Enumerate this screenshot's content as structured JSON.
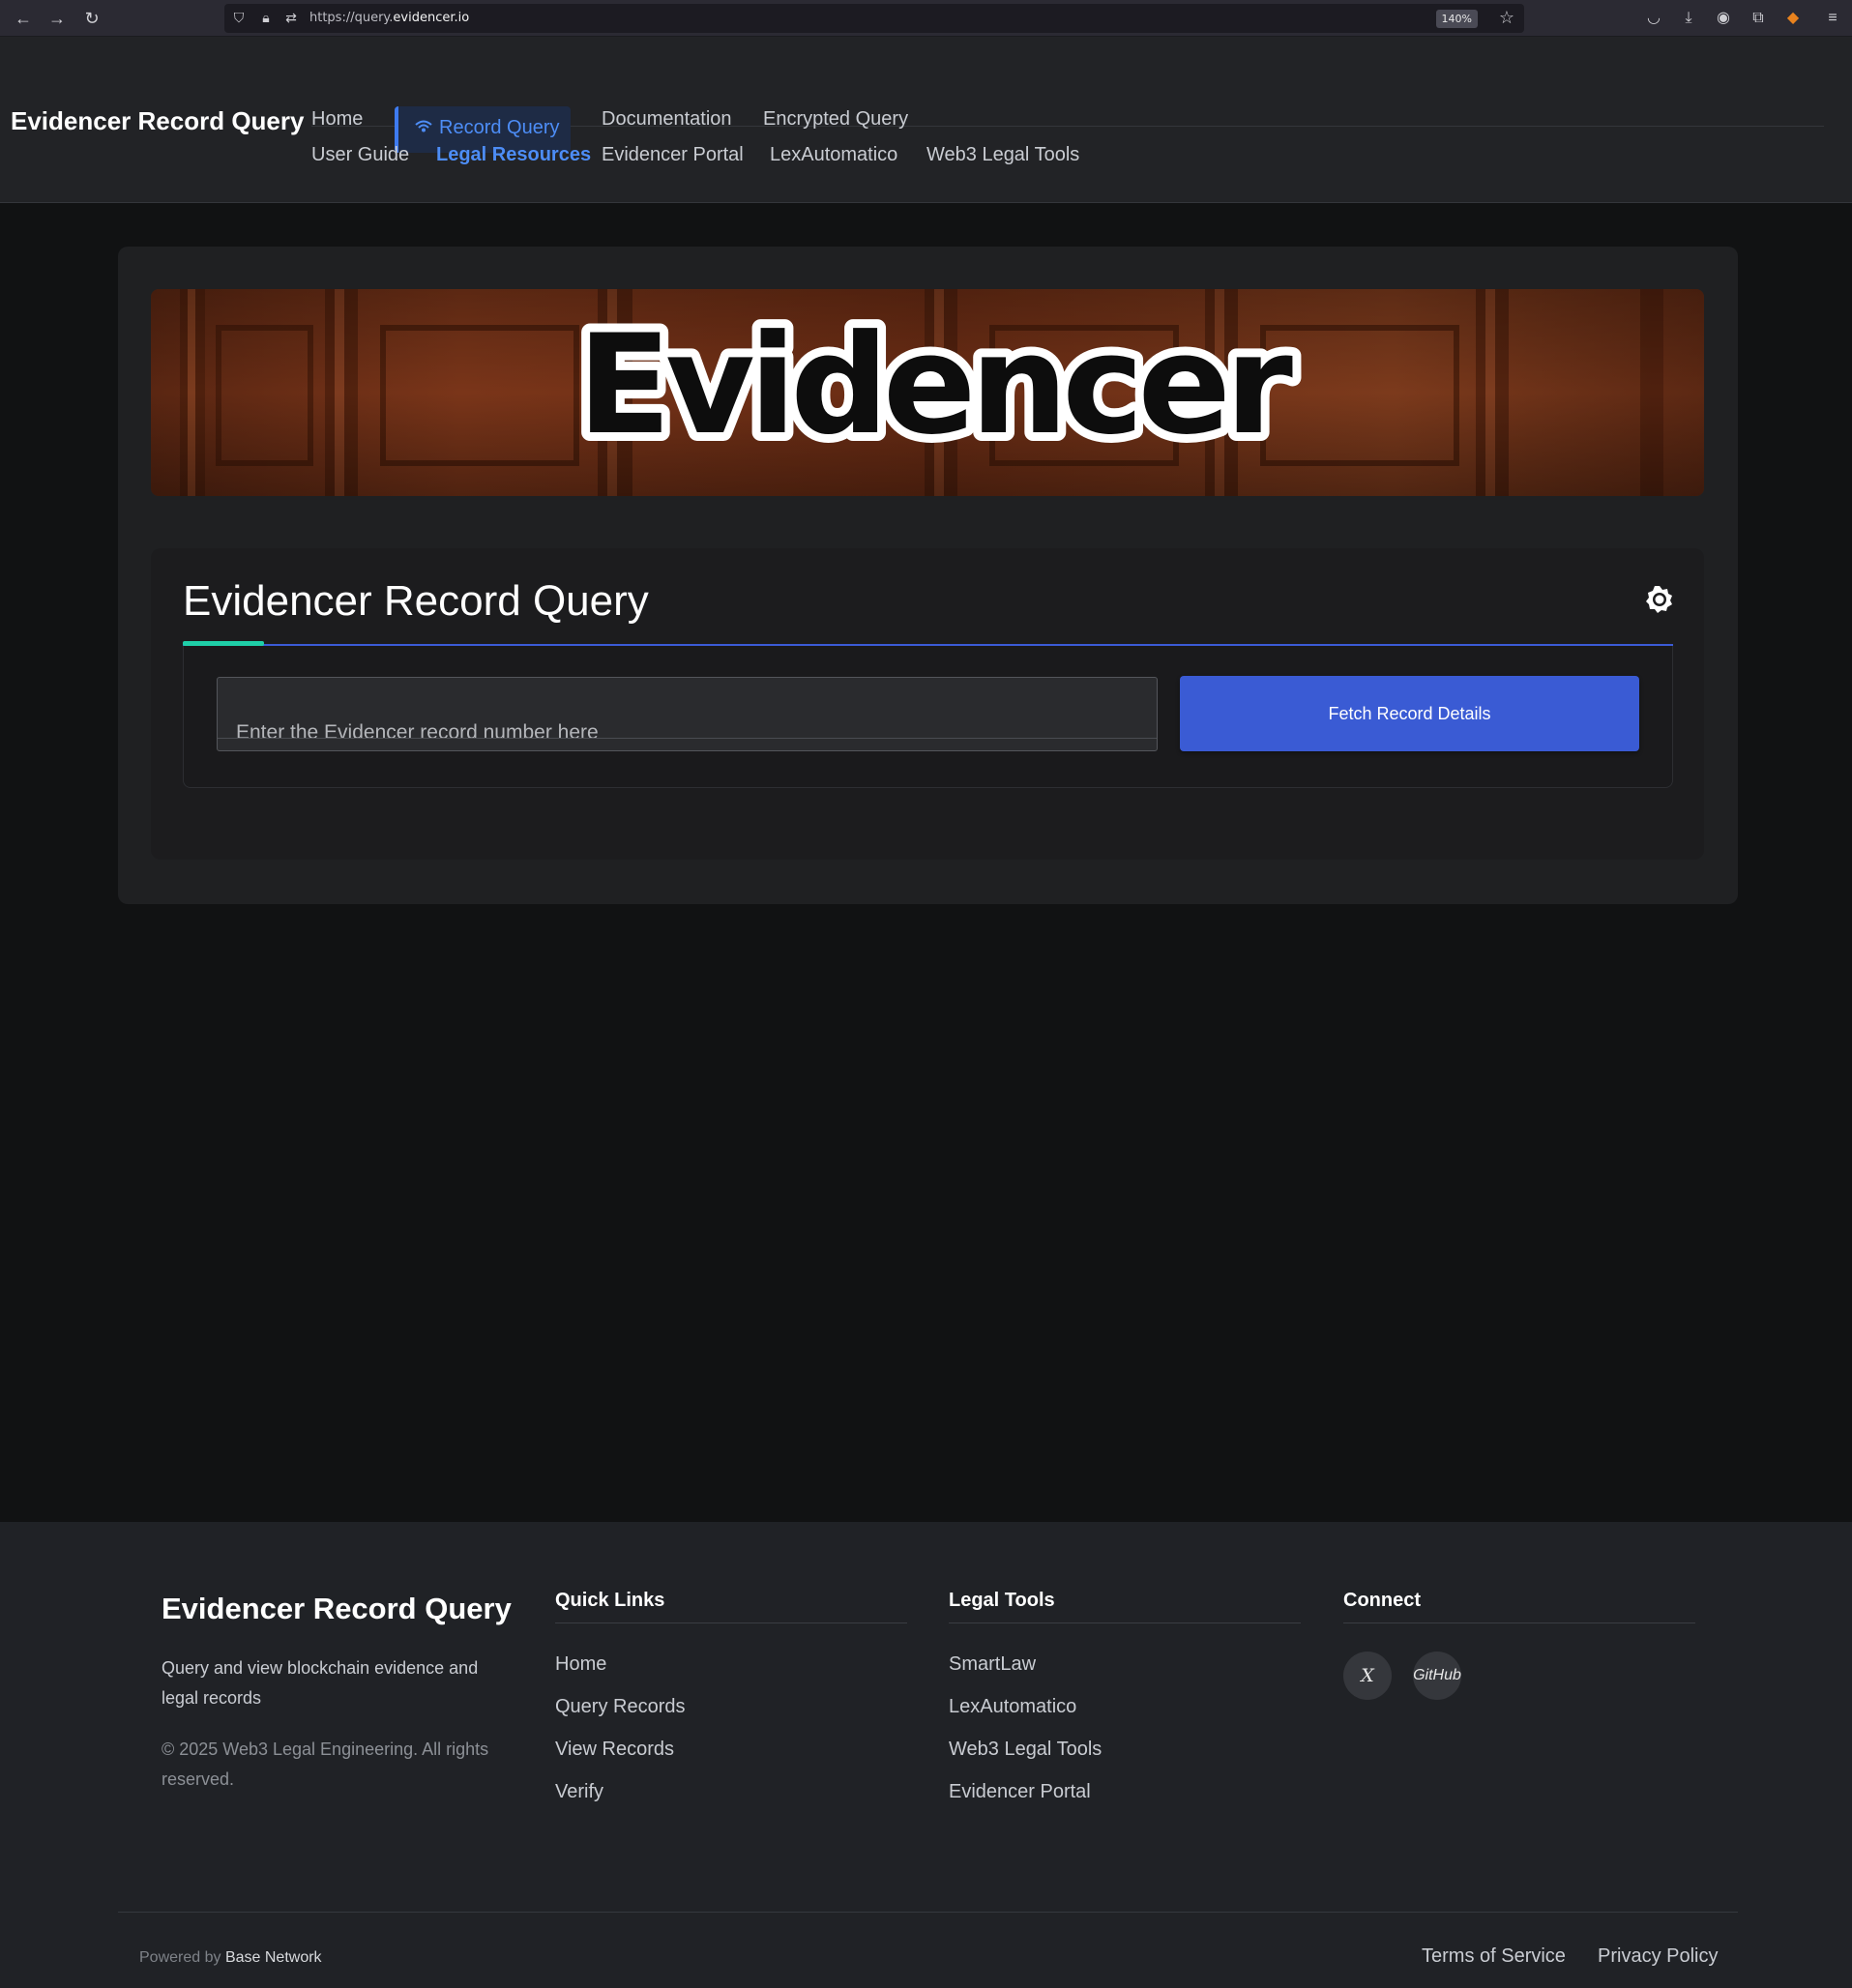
{
  "browser": {
    "url_prefix": "https://query.",
    "url_domain": "evidencer.io",
    "zoom": "140%"
  },
  "header": {
    "brand": "Evidencer Record Query",
    "nav_row1": [
      "Home",
      "Record Query",
      "Documentation",
      "Encrypted Query"
    ],
    "nav_row2": [
      "User Guide",
      "Legal Resources",
      "Evidencer Portal",
      "LexAutomatico",
      "Web3 Legal Tools"
    ],
    "active_item": "Record Query",
    "highlighted_item": "Legal Resources"
  },
  "banner": {
    "logo_text": "Evidencer"
  },
  "query": {
    "title": "Evidencer Record Query",
    "input_placeholder": "Enter the Evidencer record number here",
    "input_value": "",
    "button_label": "Fetch Record Details"
  },
  "footer": {
    "brand": "Evidencer Record Query",
    "description": "Query and view blockchain evidence and legal records",
    "copyright": "© 2025 Web3 Legal Engineering. All rights reserved.",
    "quick_links": {
      "heading": "Quick Links",
      "items": [
        "Home",
        "Query Records",
        "View Records",
        "Verify"
      ]
    },
    "legal_tools": {
      "heading": "Legal Tools",
      "items": [
        "SmartLaw",
        "LexAutomatico",
        "Web3 Legal Tools",
        "Evidencer Portal"
      ]
    },
    "connect": {
      "heading": "Connect",
      "x_label": "X",
      "github_label": "GitHub"
    },
    "powered_by": "Powered by",
    "network": "Base Network",
    "terms": "Terms of Service",
    "privacy": "Privacy Policy"
  },
  "colors": {
    "accent_blue": "#3a5bd4",
    "accent_teal": "#1fcfa8",
    "active_nav": "#4d8df6",
    "page_bg": "#111213"
  }
}
